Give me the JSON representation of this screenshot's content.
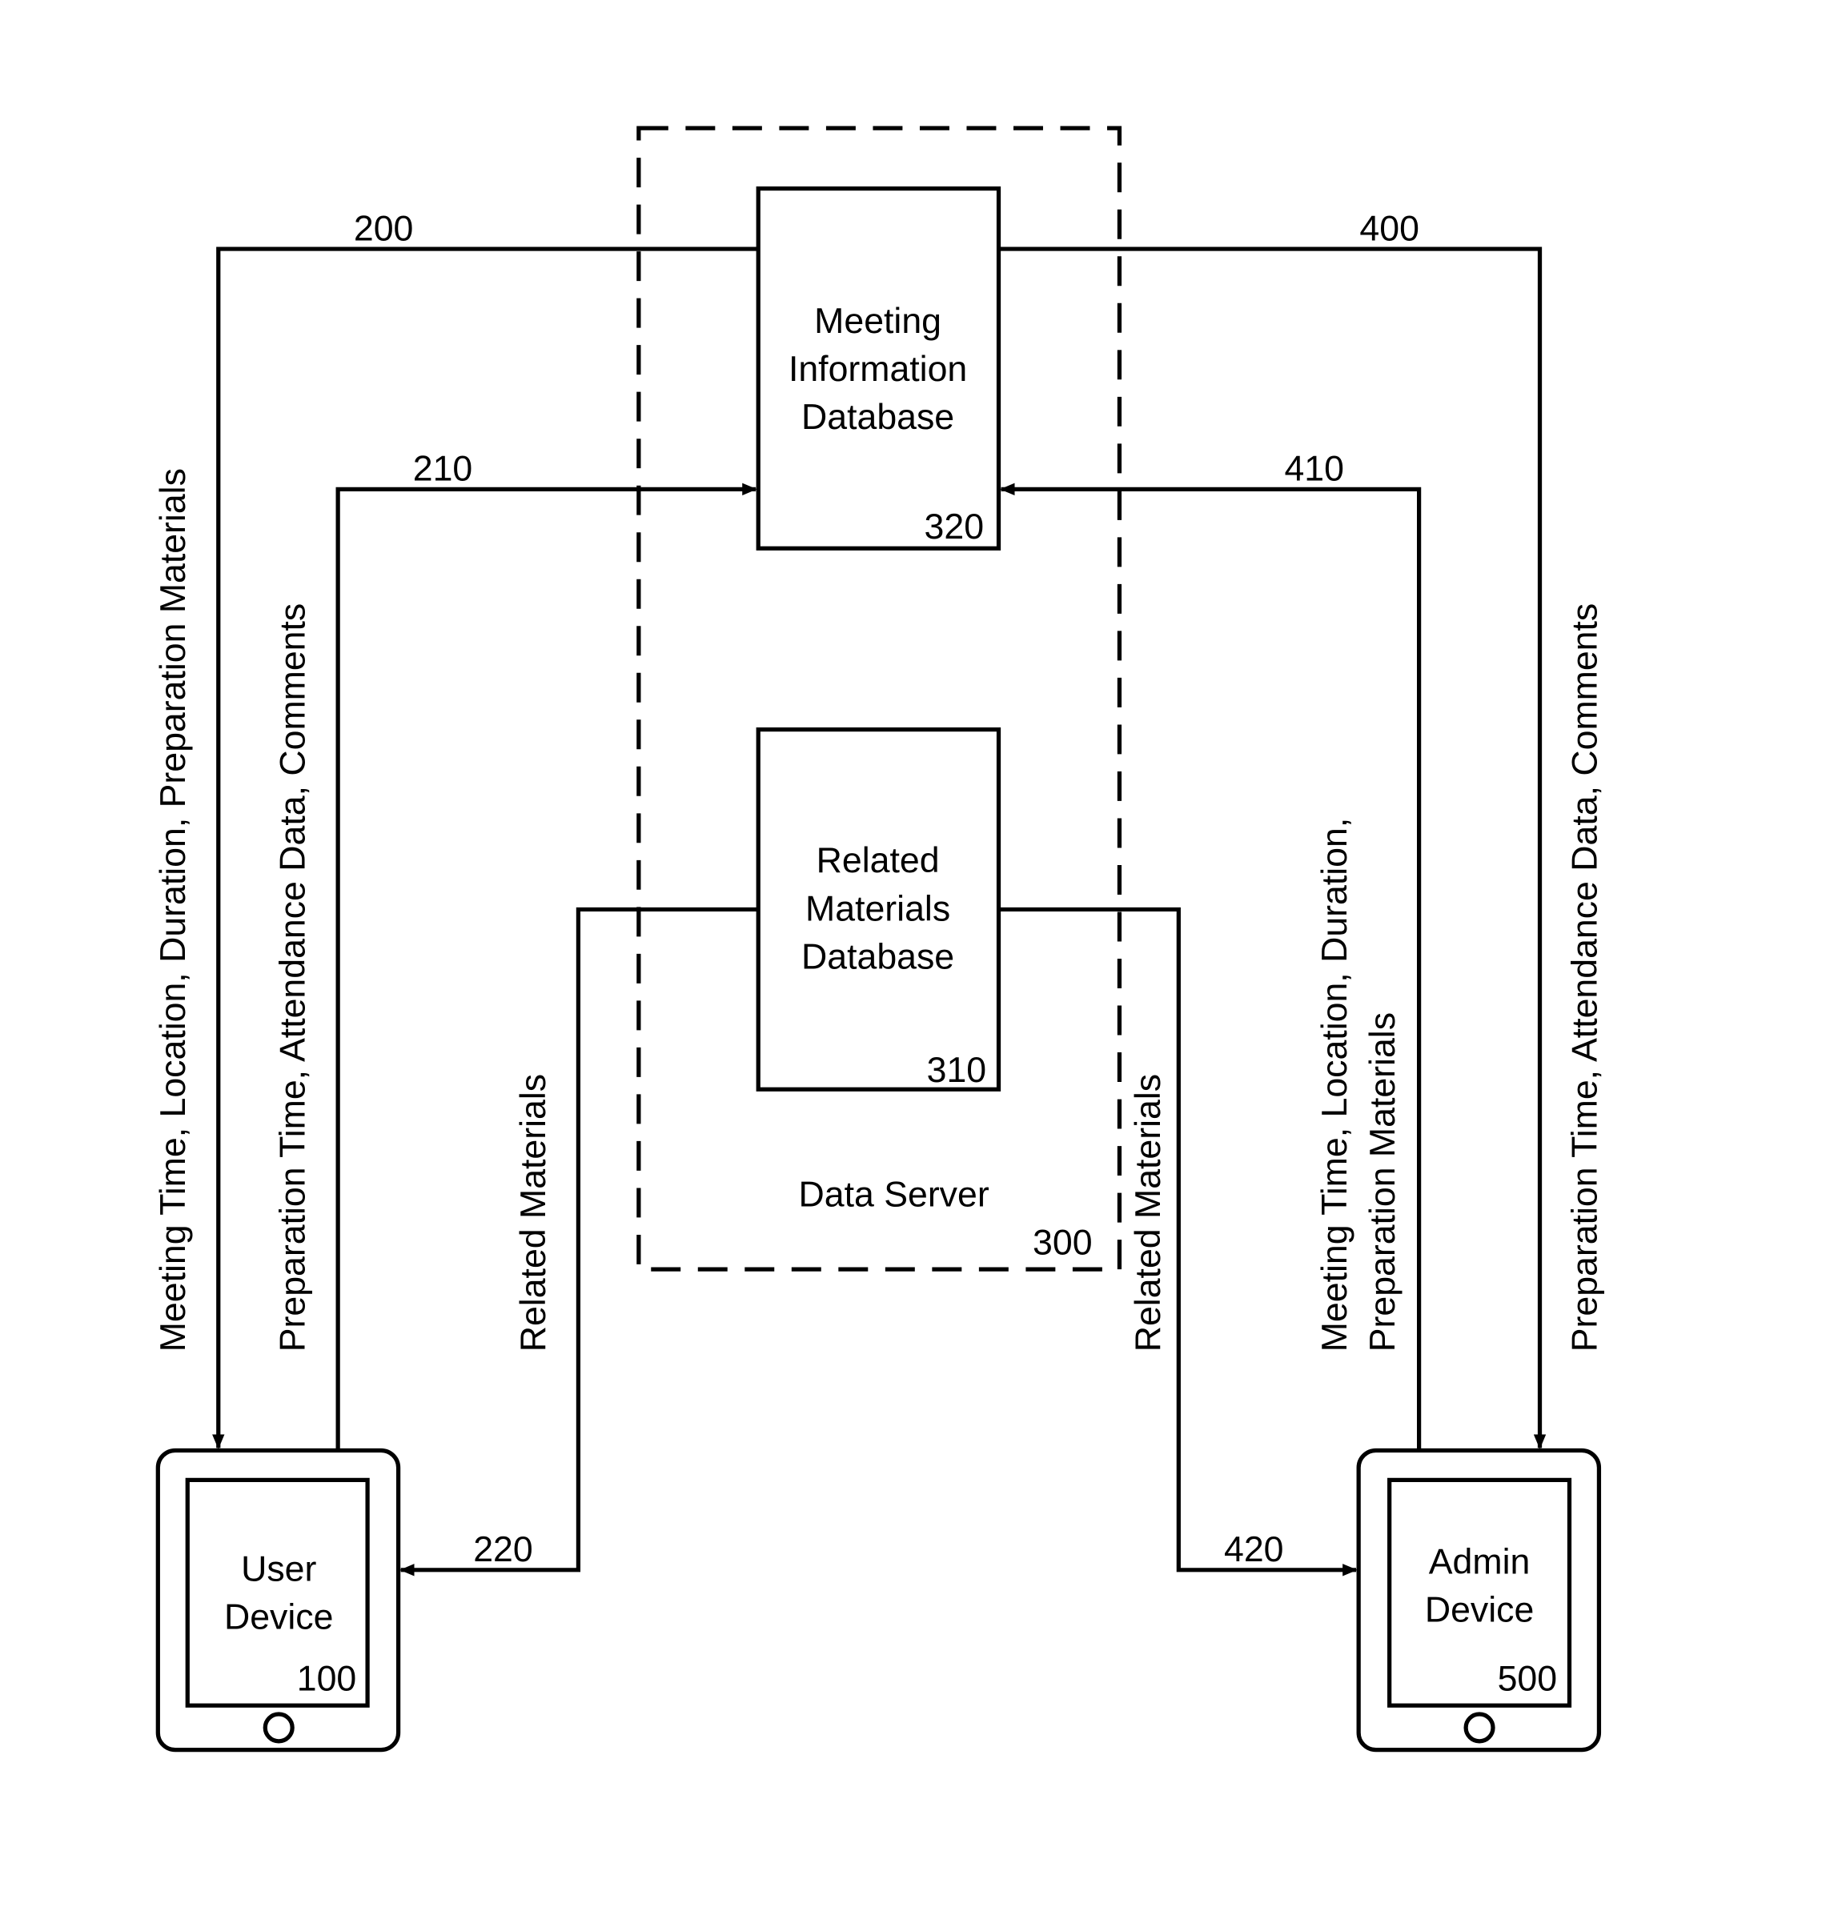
{
  "diagram": {
    "data_server": {
      "label": "Data Server",
      "ref": "300"
    },
    "meeting_db": {
      "lines": [
        "Meeting",
        "Information",
        "Database"
      ],
      "ref": "320"
    },
    "related_db": {
      "lines": [
        "Related",
        "Materials",
        "Database"
      ],
      "ref": "310"
    },
    "user_device": {
      "lines": [
        "User",
        "Device"
      ],
      "ref": "100"
    },
    "admin_device": {
      "lines": [
        "Admin",
        "Device"
      ],
      "ref": "500"
    },
    "flows": {
      "f200": {
        "ref": "200",
        "label": "Meeting Time, Location, Duration, Preparation Materials"
      },
      "f210": {
        "ref": "210",
        "label": "Preparation Time, Attendance Data, Comments"
      },
      "f220": {
        "ref": "220",
        "label": "Related Materials"
      },
      "f400": {
        "ref": "400",
        "label": "Preparation Time, Attendance Data, Comments"
      },
      "f410": {
        "ref": "410",
        "label_line1": "Meeting Time, Location, Duration,",
        "label_line2": "Preparation Materials"
      },
      "f420": {
        "ref": "420",
        "label": "Related Materials"
      }
    }
  }
}
